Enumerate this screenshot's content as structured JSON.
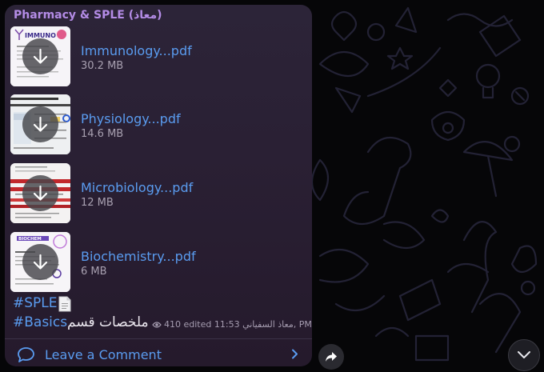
{
  "channel": {
    "name": "Pharmacy & SPLE (معاذ)"
  },
  "files": [
    {
      "name": "Immunology...pdf",
      "size": "30.2 MB",
      "thumb_title": "IMMUNOLOGY"
    },
    {
      "name": "Physiology...pdf",
      "size": "14.6 MB",
      "thumb_title": "ology Figure"
    },
    {
      "name": "Microbiology...pdf",
      "size": "12 MB",
      "thumb_title": ""
    },
    {
      "name": "Biochemistry...pdf",
      "size": "6 MB",
      "thumb_title": "BIOCHEMISTRY"
    }
  ],
  "post": {
    "hashtag_1": "#SPLE",
    "hashtag_2": "#Basics",
    "text": "ملخصات قسم",
    "views": "410",
    "edited": "edited 11:53",
    "author_time": "معاذ السفياني, PM"
  },
  "comment": {
    "label": "Leave a Comment"
  },
  "colors": {
    "accent": "#5a9cf0",
    "channel_name": "#b48ce6",
    "bubble": "#2a2034"
  },
  "icons": [
    "download-icon",
    "document-icon",
    "eye-icon",
    "comment-icon",
    "chevron-right-icon",
    "share-icon",
    "chevron-down-icon"
  ]
}
